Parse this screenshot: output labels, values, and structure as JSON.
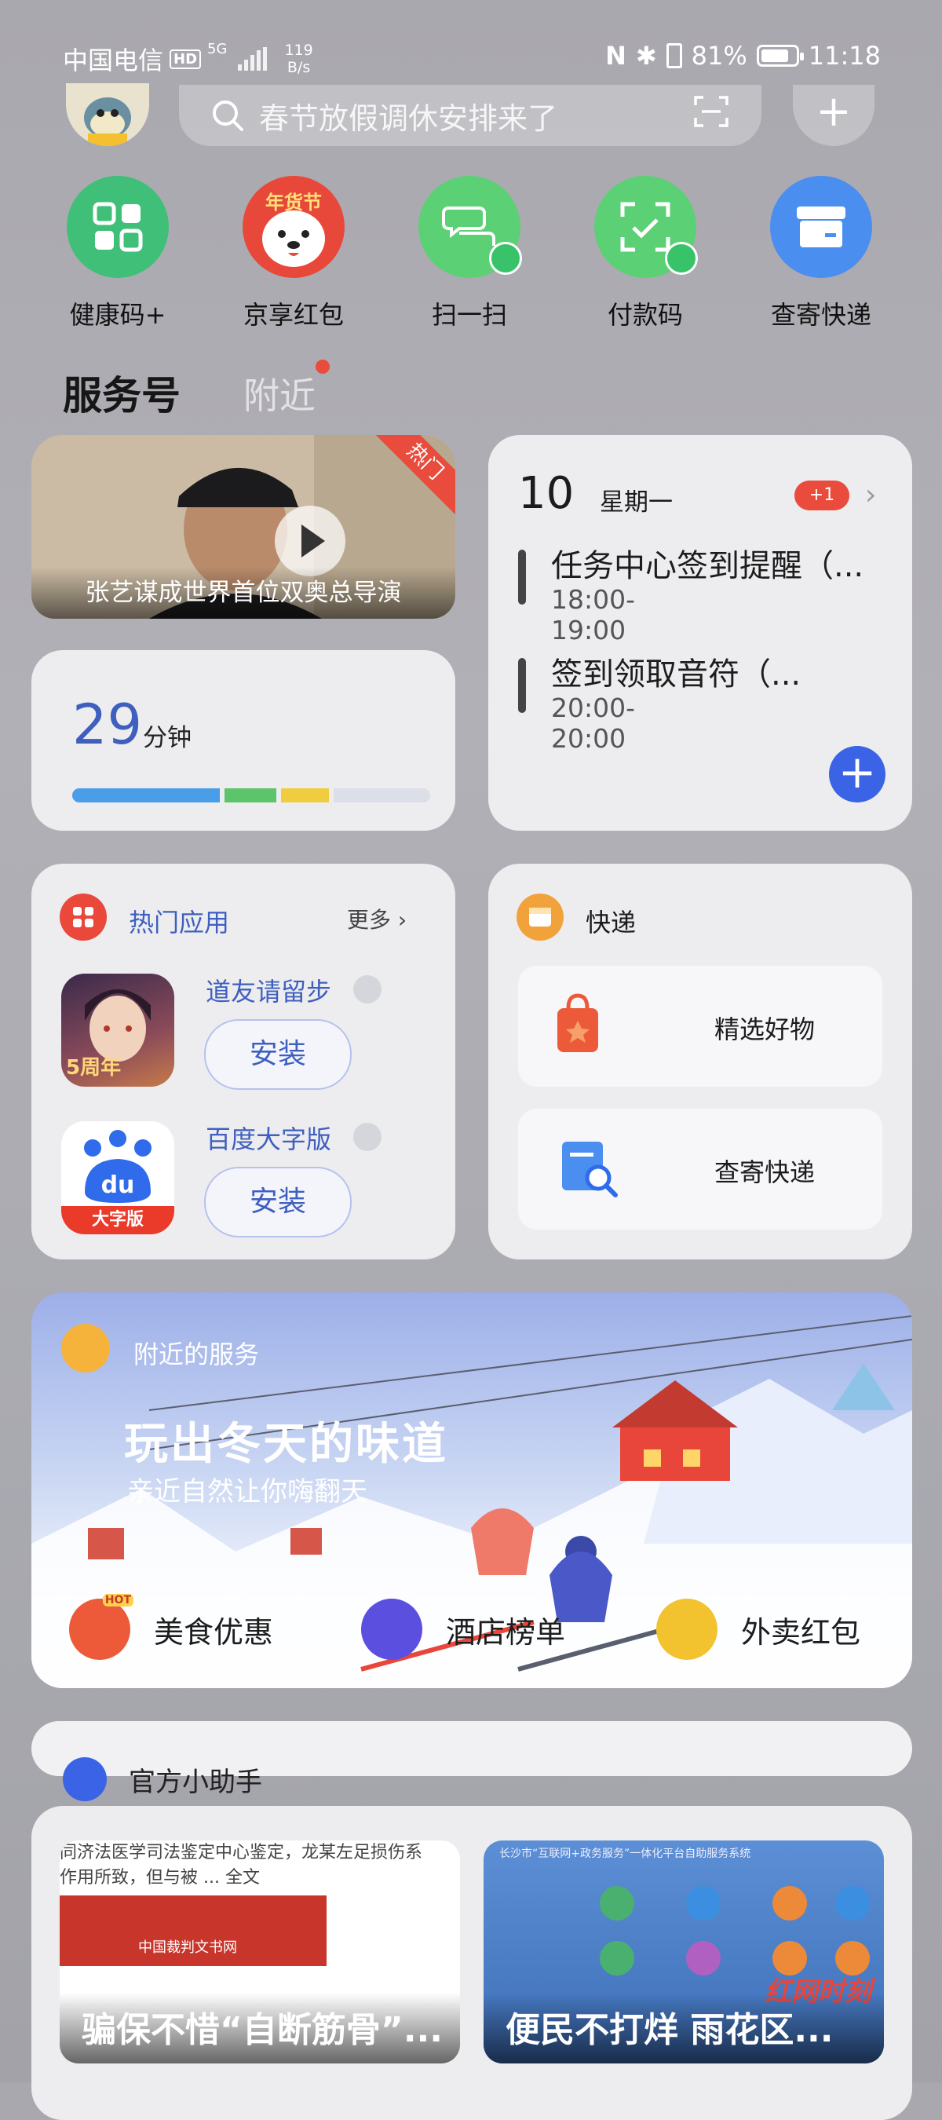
{
  "status_bar": {
    "carrier": "中国电信",
    "hd": "HD",
    "net_type": "5G",
    "net_speed_value": "119",
    "net_speed_unit": "B/s",
    "nfc": "N",
    "bluetooth": "✱",
    "battery_percent": "81%",
    "battery_level": 0.81,
    "time": "11:18"
  },
  "search": {
    "placeholder": "春节放假调休安排来了",
    "plus": "+"
  },
  "quick_apps": [
    {
      "label": "健康码+",
      "color": "#3fbf78"
    },
    {
      "label": "京享红包",
      "color": "#e8483a",
      "badge_text": "年货节"
    },
    {
      "label": "扫一扫",
      "color": "#5bd075"
    },
    {
      "label": "付款码",
      "color": "#5bd075"
    },
    {
      "label": "查寄快递",
      "color": "#4a8ef0"
    }
  ],
  "tabs": {
    "services": "服务号",
    "nearby": "附近"
  },
  "video_card": {
    "caption": "张艺谋成世界首位双奥总导演",
    "tag": "热门"
  },
  "timer_card": {
    "value": "29",
    "unit": "分钟",
    "segments": [
      {
        "fraction": 0.43,
        "color": "#4a9ee8"
      },
      {
        "fraction": 0.15,
        "color": "#5cc46a"
      },
      {
        "fraction": 0.14,
        "color": "#f0cd3e"
      },
      {
        "fraction": 0.28,
        "color": "#dcdfe8"
      }
    ]
  },
  "calendar_card": {
    "day": "10",
    "weekday": "星期一",
    "badge": "+1",
    "chevron": "›",
    "events": [
      {
        "title": "任务中心签到提醒（...",
        "time": "18:00-19:00"
      },
      {
        "title": "签到领取音符（...",
        "time": "20:00-20:00"
      }
    ],
    "add": "+"
  },
  "hot_apps": {
    "title": "热门应用",
    "more": "更多 ›",
    "apps": [
      {
        "name": "道友请留步",
        "install": "安装",
        "icon_label": "5周年"
      },
      {
        "name": "百度大字版",
        "install": "安装",
        "icon_label": "du",
        "icon_sub": "大字版"
      }
    ]
  },
  "express": {
    "title": "快递",
    "items": [
      {
        "label": "精选好物",
        "icon_color": "#ec5a3a"
      },
      {
        "label": "查寄快递",
        "icon_color": "#4a8ef0"
      }
    ]
  },
  "nearby": {
    "title": "附近的服务",
    "headline": "玩出冬天的味道",
    "subline": "亲近自然让你嗨翻天",
    "services": [
      {
        "label": "美食优惠",
        "color": "#ec5a3a",
        "tag": "HOT"
      },
      {
        "label": "酒店榜单",
        "color": "#5b4fe0"
      },
      {
        "label": "外卖红包",
        "color": "#f2c32e"
      }
    ]
  },
  "assistant": {
    "label": "官方小助手"
  },
  "news": [
    {
      "caption": "骗保不惜“自断筋骨”...",
      "snippet": "同济法医学司法鉴定中心鉴定，龙某左足损伤系\n作用所致，但与被 ... 全文",
      "doc_title": "中国裁判文书网"
    },
    {
      "caption": "便民不打烊 雨花区...",
      "snippet": "长沙市“互联网+政务服务”一体化平台自助服务系统",
      "watermark": "红网时刻"
    }
  ]
}
